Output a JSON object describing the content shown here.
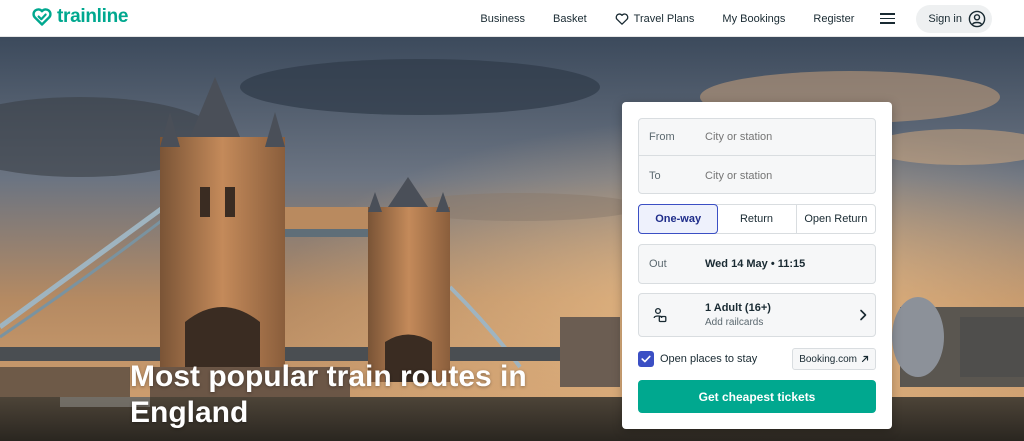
{
  "brand": {
    "name": "trainline",
    "color": "#00a88f"
  },
  "nav": {
    "business": "Business",
    "basket": "Basket",
    "travel_plans": "Travel Plans",
    "my_bookings": "My Bookings",
    "register": "Register",
    "sign_in": "Sign in",
    "icons": {
      "travel_plans": "heart-icon",
      "menu": "hamburger-menu-icon",
      "sign_in": "user-circle-icon"
    }
  },
  "hero": {
    "title": "Most popular train routes in England"
  },
  "search": {
    "from_label": "From",
    "from_placeholder": "City or station",
    "to_label": "To",
    "to_placeholder": "City or station",
    "trip_types": [
      "One-way",
      "Return",
      "Open Return"
    ],
    "trip_type_selected": "One-way",
    "out_label": "Out",
    "out_value": "Wed 14 May • 11:15",
    "passengers": "1 Adult (16+)",
    "railcards": "Add railcards",
    "open_places_label": "Open places to stay",
    "open_places_checked": true,
    "partner": "Booking.com",
    "cta": "Get cheapest tickets",
    "accent": "#3b4fc4"
  }
}
